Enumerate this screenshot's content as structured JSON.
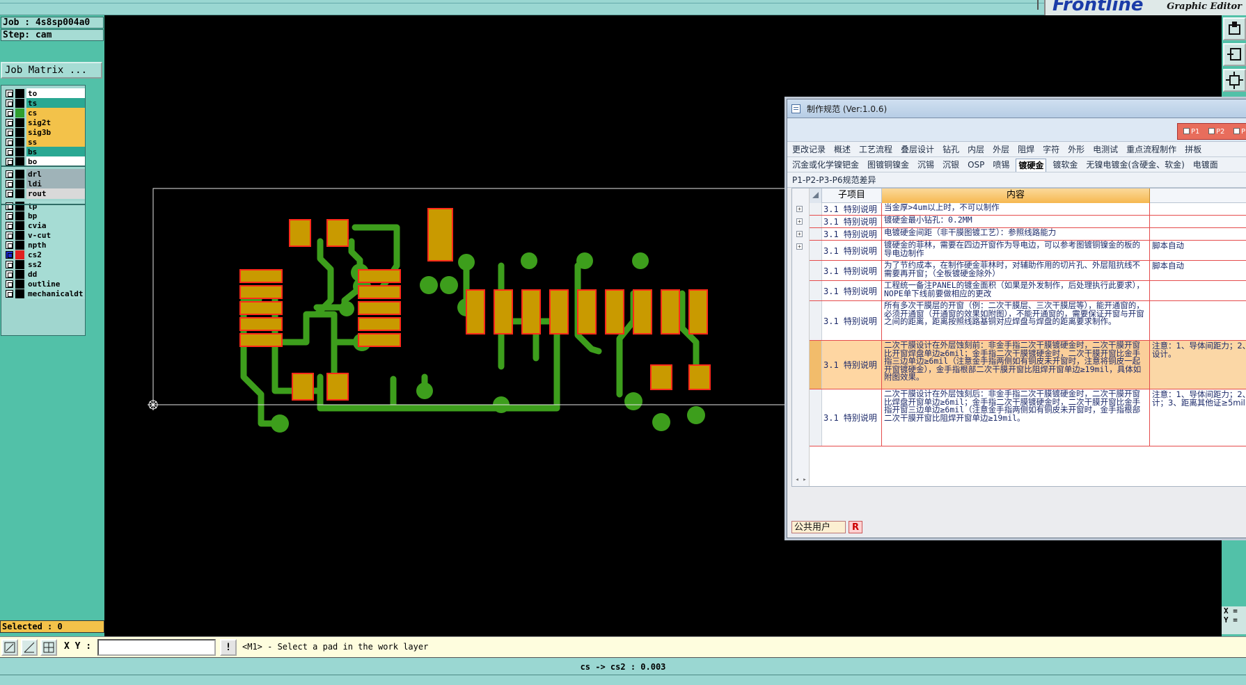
{
  "app": {
    "brand": "Frontline",
    "brand_sub": "Graphic Editor"
  },
  "left_panel": {
    "job": "Job : 4s8sp004a0",
    "step": "Step: cam",
    "job_matrix_label": "Job Matrix ...",
    "selected": "Selected : 0",
    "layers": [
      {
        "name": "to",
        "bg": "#ffffff",
        "swatch": "#000000"
      },
      {
        "name": "ts",
        "bg": "#2aa893",
        "swatch": "#000000"
      },
      {
        "name": "cs",
        "bg": "#f3c24a",
        "swatch": "#2e9e2e"
      },
      {
        "name": "sig2t",
        "bg": "#f3c24a",
        "swatch": "#000000"
      },
      {
        "name": "sig3b",
        "bg": "#f3c24a",
        "swatch": "#000000"
      },
      {
        "name": "ss",
        "bg": "#f3c24a",
        "swatch": "#000000"
      },
      {
        "name": "bs",
        "bg": "#2aa893",
        "swatch": "#000000"
      },
      {
        "name": "bo",
        "bg": "#ffffff",
        "swatch": "#000000"
      },
      {
        "name": "drl",
        "bg": "#9fb3b8",
        "swatch": "#000000"
      },
      {
        "name": "ldi",
        "bg": "#9fb3b8",
        "swatch": "#000000"
      },
      {
        "name": "rout",
        "bg": "#d9d9d9",
        "swatch": "#000000"
      },
      {
        "name": "tp",
        "bg": "#a6dcd4",
        "swatch": "#000000"
      },
      {
        "name": "bp",
        "bg": "#a6dcd4",
        "swatch": "#000000"
      },
      {
        "name": "cvia",
        "bg": "#a6dcd4",
        "swatch": "#000000"
      },
      {
        "name": "v-cut",
        "bg": "#a6dcd4",
        "swatch": "#000000"
      },
      {
        "name": "npth",
        "bg": "#a6dcd4",
        "swatch": "#000000"
      },
      {
        "name": "cs2",
        "bg": "#a6dcd4",
        "swatch": "#e02020",
        "active": true
      },
      {
        "name": "ss2",
        "bg": "#a6dcd4",
        "swatch": "#000000"
      },
      {
        "name": "dd",
        "bg": "#a6dcd4",
        "swatch": "#000000"
      },
      {
        "name": "outline",
        "bg": "#a6dcd4",
        "swatch": "#000000"
      },
      {
        "name": "mechanicaldt",
        "bg": "#a6dcd4",
        "swatch": "#000000"
      }
    ]
  },
  "command_bar": {
    "xy_label": "X Y :",
    "xy_value": "",
    "help_label": "!",
    "prompt": "<M1> - Select a pad in the work layer"
  },
  "status": {
    "text": "cs -> cs2 : 0.003"
  },
  "coords": {
    "x": "X =",
    "y": "Y ="
  },
  "pcb_colors": {
    "trace": "#3d9e1c",
    "pad_fill": "#c99a00",
    "pad_outline": "#ff2b1a",
    "profile": "#e6e6e6"
  },
  "dialog": {
    "title": "制作规范 (Ver:1.0.6)",
    "p_checks": [
      "P1",
      "P2",
      "P"
    ],
    "tabs_row1": [
      "更改记录",
      "概述",
      "工艺流程",
      "叠层设计",
      "钻孔",
      "内层",
      "外层",
      "阻焊",
      "字符",
      "外形",
      "电测试",
      "重点流程制作",
      "拼板"
    ],
    "tabs_row2": [
      "沉金或化学镍钯金",
      "图镀铜镍金",
      "沉锡",
      "沉银",
      "OSP",
      "喷锡",
      "镀硬金",
      "镀软金",
      "无镍电镀金(含硬金、软金)",
      "电镀面"
    ],
    "tabs_row2_active": "镀硬金",
    "tabs_row3": [
      "P1-P2-P3-P6规范差异"
    ],
    "grid": {
      "col_sub": "子项目",
      "col_content": "内容",
      "rows": [
        {
          "sub": "3.1 特别说明",
          "content": "当金厚>4um以上时，不可以制作",
          "note": ""
        },
        {
          "sub": "3.1 特别说明",
          "content": "镀硬金最小钻孔：0.2MM",
          "note": ""
        },
        {
          "sub": "3.1 特别说明",
          "content": "电镀硬金间距（非干膜图镀工艺）：参照线路能力",
          "note": ""
        },
        {
          "sub": "3.1 特别说明",
          "content": "镀硬金的菲林，需要在四边开窗作为导电边，可以参考图镀铜镍金的板的导电边制作",
          "note": "脚本自动"
        },
        {
          "sub": "3.1 特别说明",
          "content": "为了节约成本，在制作硬金菲林时，对辅助作用的切片孔、外层阻抗线不需要再开窗；（全板镀硬金除外）",
          "note": "脚本自动"
        },
        {
          "sub": "3.1 特别说明",
          "content": "工程统一备注PANEL的镀金面积（如果是外发制作，后处理执行此要求），NOPE单下线前要做相应的更改",
          "note": ""
        },
        {
          "sub": "3.1 特别说明",
          "content": "所有多次干膜层的开窗（例：二次干膜层、三次干膜层等），能开通窗的，必须开通窗（开通窗的效果如附图），不能开通窗的，需要保证开窗与开窗之间的距离，距离按照线路基铜对应焊盘与焊盘的距离要求制作。",
          "note": ""
        },
        {
          "sub": "3.1 特别说明",
          "content": "二次干膜设计在外层蚀刻前：非金手指二次干膜镀硬金时，二次干膜开窗比开窗焊盘单边≥6mil；金手指二次干膜镀硬金时，二次干膜开窗比金手指三边单边≥6mil（注意金手指两侧如有铜皮未开窗时，注意将铜皮一起开窗镀硬金），金手指根部二次干膜开窗比阻焊开窗单边≥19mil，具体如附图效果。",
          "note": "注意：1、导体间距力；2、设计。",
          "highlight": true
        },
        {
          "sub": "3.1 特别说明",
          "content": "二次干膜设计在外层蚀刻后：非金手指二次干膜镀硬金时，二次干膜开窗比焊盘开窗单边≥6mil；金手指二次干膜镀硬金时，二次干膜开窗比金手指开窗三边单边≥6mil（注意金手指两侧如有铜皮未开窗时，金手指根部二次干膜开窗比阻焊开窗单边≥19mil。",
          "note": "注意：1、导体间距力；2、计；3、距离其他证≥5mil"
        }
      ]
    },
    "footer_user": "公共用户",
    "footer_badge": "R"
  }
}
